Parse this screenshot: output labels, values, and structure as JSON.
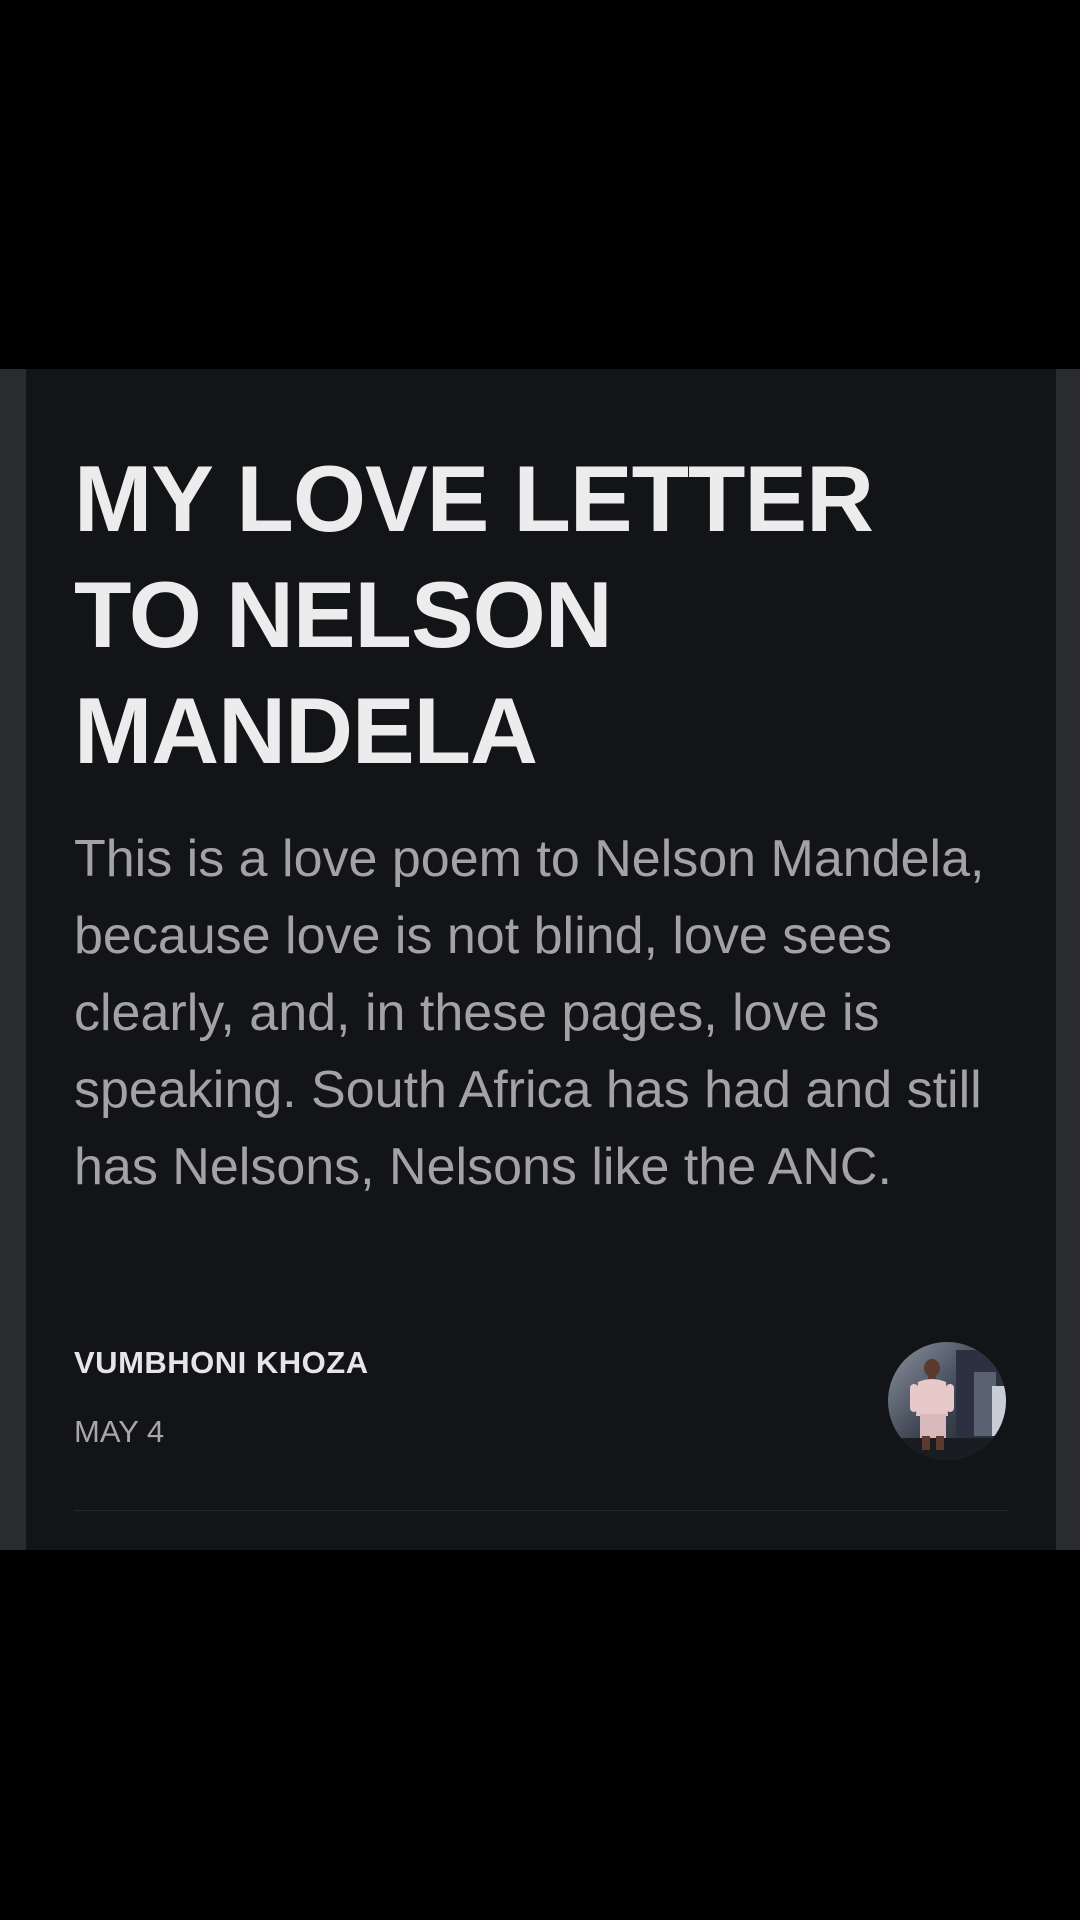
{
  "article": {
    "title": "MY LOVE LETTER TO NELSON MANDELA",
    "excerpt": "This is a love poem to Nelson Mandela, because love is not blind, love sees clearly, and, in these pages, love is speaking. South Africa has had and still has Nelsons, Nelsons like the ANC.",
    "author": "VUMBHONI KHOZA",
    "date": "MAY 4"
  },
  "colors": {
    "background": "#000000",
    "card": "#131417",
    "title": "#ececec",
    "body_text": "#a3a3a6"
  }
}
